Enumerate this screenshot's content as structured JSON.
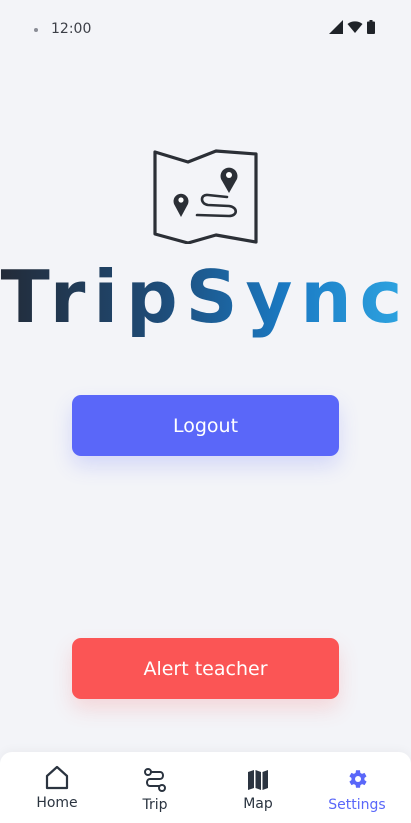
{
  "status_bar": {
    "time": "12:00"
  },
  "app": {
    "brand_name": "TripSync",
    "logo_icon": "map-route-icon"
  },
  "actions": {
    "logout_label": "Logout",
    "alert_label": "Alert teacher"
  },
  "bottom_nav": {
    "items": [
      {
        "label": "Home",
        "icon": "home-icon"
      },
      {
        "label": "Trip",
        "icon": "route-icon"
      },
      {
        "label": "Map",
        "icon": "map-icon"
      },
      {
        "label": "Settings",
        "icon": "gear-icon",
        "active": true
      }
    ]
  },
  "colors": {
    "background": "#f3f4f8",
    "primary": "#5a67f9",
    "danger": "#fb5555",
    "nav_text": "#2b3440"
  }
}
